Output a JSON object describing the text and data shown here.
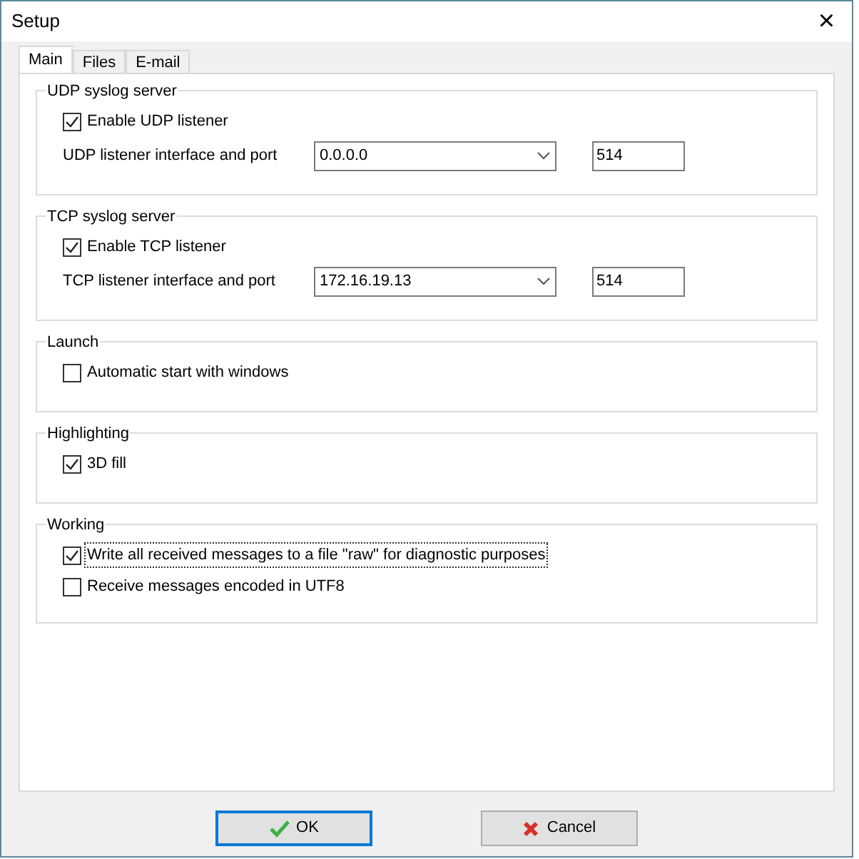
{
  "window": {
    "title": "Setup",
    "close": "×"
  },
  "tabs": [
    {
      "label": "Main",
      "selected": true
    },
    {
      "label": "Files",
      "selected": false
    },
    {
      "label": "E-mail",
      "selected": false
    }
  ],
  "sections": [
    {
      "title": "UDP syslog server",
      "rows": [
        {
          "kind": "checkbox",
          "label": "Enable UDP listener",
          "checked": true,
          "focused": false
        },
        {
          "kind": "endpoint",
          "label": "UDP listener interface and port",
          "address": "0.0.0.0",
          "port": "514"
        }
      ]
    },
    {
      "title": "TCP syslog server",
      "rows": [
        {
          "kind": "checkbox",
          "label": "Enable TCP listener",
          "checked": true,
          "focused": false
        },
        {
          "kind": "endpoint",
          "label": "TCP listener interface and port",
          "address": "172.16.19.13",
          "port": "514"
        }
      ]
    },
    {
      "title": "Launch",
      "rows": [
        {
          "kind": "checkbox",
          "label": "Automatic start with windows",
          "checked": false,
          "focused": false
        }
      ]
    },
    {
      "title": "Highlighting",
      "rows": [
        {
          "kind": "checkbox",
          "label": "3D fill",
          "checked": true,
          "focused": false
        }
      ]
    },
    {
      "title": "Working",
      "rows": [
        {
          "kind": "checkbox",
          "label": "Write all received messages to a file \"raw\" for diagnostic purposes",
          "checked": true,
          "focused": true
        },
        {
          "kind": "checkbox",
          "label": "Receive messages encoded in UTF8",
          "checked": false,
          "focused": false
        }
      ]
    }
  ],
  "buttons": [
    {
      "kind": "ok",
      "label": "OK",
      "default": true
    },
    {
      "kind": "cancel",
      "label": "Cancel",
      "default": false
    }
  ]
}
